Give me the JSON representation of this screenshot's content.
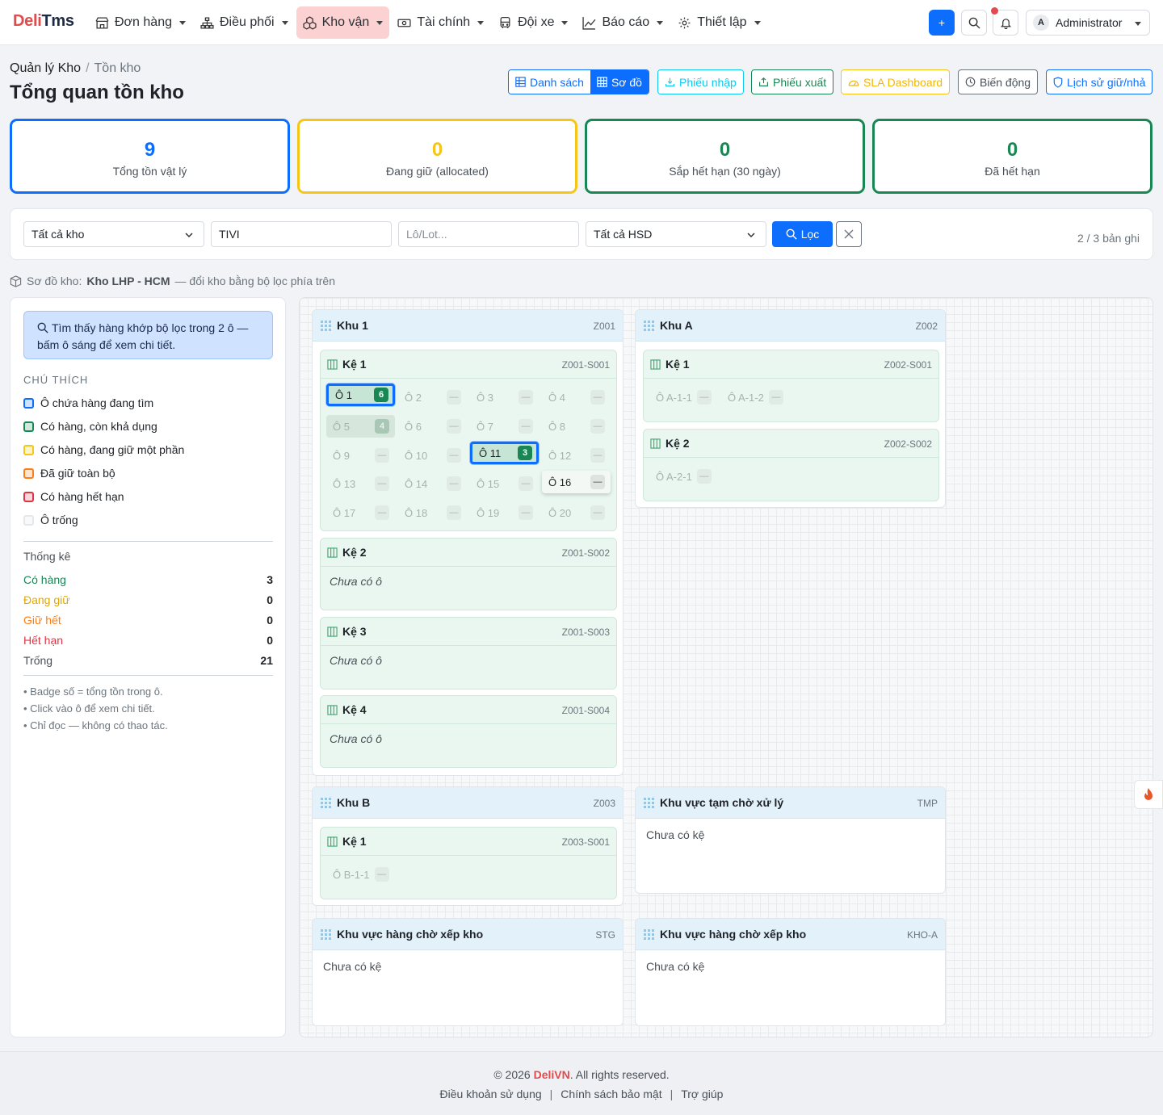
{
  "logo": {
    "part1": "Deli",
    "part2": "Tms"
  },
  "nav": [
    {
      "label": "Đơn hàng",
      "icon": "store-icon"
    },
    {
      "label": "Điều phối",
      "icon": "network-icon"
    },
    {
      "label": "Kho vận",
      "icon": "boxes-icon",
      "active": true
    },
    {
      "label": "Tài chính",
      "icon": "cash-icon"
    },
    {
      "label": "Đội xe",
      "icon": "bus-icon"
    },
    {
      "label": "Báo cáo",
      "icon": "chart-icon"
    },
    {
      "label": "Thiết lập",
      "icon": "gear-icon"
    }
  ],
  "topbar": {
    "add_label": "+",
    "user_initial": "A",
    "user_name": "Administrator"
  },
  "breadcrumb": {
    "root": "Quản lý Kho",
    "sep": "/",
    "current": "Tồn kho"
  },
  "page_title": "Tổng quan tồn kho",
  "view_toggle": {
    "list": "Danh sách",
    "map": "Sơ đồ"
  },
  "actions": {
    "import": "Phiếu nhập",
    "export": "Phiếu xuất",
    "sla": "SLA Dashboard",
    "movement": "Biến động",
    "history": "Lịch sử giữ/nhả"
  },
  "stats": [
    {
      "value": "9",
      "label": "Tổng tồn vật lý",
      "color": "#0d6efd"
    },
    {
      "value": "0",
      "label": "Đang giữ (allocated)",
      "color": "#f5c518"
    },
    {
      "value": "0",
      "label": "Sắp hết hạn (30 ngày)",
      "color": "#198754"
    },
    {
      "value": "0",
      "label": "Đã hết hạn",
      "color": "#198754"
    }
  ],
  "filter": {
    "warehouse": "Tất cả kho",
    "product": "TIVI",
    "lot_placeholder": "Lô/Lot...",
    "expiry": "Tất cả HSD",
    "filter_button": "Lọc",
    "record_count": "2 / 3 bản ghi"
  },
  "map_note": {
    "prefix": "Sơ đồ kho:",
    "warehouse": "Kho LHP - HCM",
    "suffix": "— đổi kho bằng bộ lọc phía trên"
  },
  "sidebar": {
    "alert": "Tìm thấy hàng khớp bộ lọc trong 2 ô — bấm ô sáng để xem chi tiết.",
    "legend_title": "CHÚ THÍCH",
    "legend": [
      {
        "label": "Ô chứa hàng đang tìm",
        "color": "#0d6efd",
        "fill": "#cfe2ff"
      },
      {
        "label": "Có hàng, còn khả dụng",
        "color": "#198754",
        "fill": "#d1e7dd"
      },
      {
        "label": "Có hàng, đang giữ một phần",
        "color": "#f5c518",
        "fill": "#fff3cd"
      },
      {
        "label": "Đã giữ toàn bộ",
        "color": "#fd7e14",
        "fill": "#ffe5d0"
      },
      {
        "label": "Có hàng hết hạn",
        "color": "#dc3545",
        "fill": "#f8d7da"
      },
      {
        "label": "Ô trống",
        "color": "#e5e7ea",
        "fill": "#f8f9fa"
      }
    ],
    "stats_title": "Thống kê",
    "stats": [
      {
        "label": "Có hàng",
        "value": "3",
        "color": "#198754"
      },
      {
        "label": "Đang giữ",
        "value": "0",
        "color": "#e0a800"
      },
      {
        "label": "Giữ hết",
        "value": "0",
        "color": "#fd7e14"
      },
      {
        "label": "Hết hạn",
        "value": "0",
        "color": "#dc3545"
      },
      {
        "label": "Trống",
        "value": "21",
        "color": "#495057"
      }
    ],
    "notes": [
      "• Badge số = tổng tồn trong ô.",
      "• Click vào ô để xem chi tiết.",
      "• Chỉ đọc — không có thao tác."
    ]
  },
  "zones": {
    "z1": {
      "name": "Khu 1",
      "code": "Z001"
    },
    "za": {
      "name": "Khu A",
      "code": "Z002"
    },
    "zb": {
      "name": "Khu B",
      "code": "Z003"
    },
    "tmp": {
      "name": "Khu vực tạm chờ xử lý",
      "code": "TMP",
      "empty": "Chưa có kệ"
    },
    "stg": {
      "name": "Khu vực hàng chờ xếp kho",
      "code": "STG",
      "empty": "Chưa có kệ"
    },
    "khoa": {
      "name": "Khu vực hàng chờ xếp kho",
      "code": "KHO-A",
      "empty": "Chưa có kệ"
    }
  },
  "shelves": {
    "z1s1": {
      "name": "Kệ 1",
      "code": "Z001-S001"
    },
    "z1s2": {
      "name": "Kệ 2",
      "code": "Z001-S002",
      "empty": "Chưa có ô"
    },
    "z1s3": {
      "name": "Kệ 3",
      "code": "Z001-S003",
      "empty": "Chưa có ô"
    },
    "z1s4": {
      "name": "Kệ 4",
      "code": "Z001-S004",
      "empty": "Chưa có ô"
    },
    "zas1": {
      "name": "Kệ 1",
      "code": "Z002-S001"
    },
    "zas2": {
      "name": "Kệ 2",
      "code": "Z002-S002"
    },
    "zbs1": {
      "name": "Kệ 1",
      "code": "Z003-S001"
    }
  },
  "cells_z1s1": [
    {
      "label": "Ô 1",
      "badge": "6",
      "state": "hit"
    },
    {
      "label": "Ô 2",
      "badge": "—",
      "state": "empty"
    },
    {
      "label": "Ô 3",
      "badge": "—",
      "state": "empty"
    },
    {
      "label": "Ô 4",
      "badge": "—",
      "state": "empty"
    },
    {
      "label": "Ô 5",
      "badge": "4",
      "state": "has"
    },
    {
      "label": "Ô 6",
      "badge": "—",
      "state": "empty"
    },
    {
      "label": "Ô 7",
      "badge": "—",
      "state": "empty"
    },
    {
      "label": "Ô 8",
      "badge": "—",
      "state": "empty"
    },
    {
      "label": "Ô 9",
      "badge": "—",
      "state": "empty"
    },
    {
      "label": "Ô 10",
      "badge": "—",
      "state": "empty"
    },
    {
      "label": "Ô 11",
      "badge": "3",
      "state": "hit"
    },
    {
      "label": "Ô 12",
      "badge": "—",
      "state": "empty"
    },
    {
      "label": "Ô 13",
      "badge": "—",
      "state": "empty"
    },
    {
      "label": "Ô 14",
      "badge": "—",
      "state": "empty"
    },
    {
      "label": "Ô 15",
      "badge": "—",
      "state": "empty"
    },
    {
      "label": "Ô 16",
      "badge": "—",
      "state": "hover"
    },
    {
      "label": "Ô 17",
      "badge": "—",
      "state": "empty"
    },
    {
      "label": "Ô 18",
      "badge": "—",
      "state": "empty"
    },
    {
      "label": "Ô 19",
      "badge": "—",
      "state": "empty"
    },
    {
      "label": "Ô 20",
      "badge": "—",
      "state": "empty"
    }
  ],
  "cells_small": {
    "a11": {
      "label": "Ô A-1-1",
      "badge": "—"
    },
    "a12": {
      "label": "Ô A-1-2",
      "badge": "—"
    },
    "a21": {
      "label": "Ô A-2-1",
      "badge": "—"
    },
    "b11": {
      "label": "Ô B-1-1",
      "badge": "—"
    }
  },
  "footer": {
    "copy_prefix": "© 2026",
    "brand": "DeliVN",
    "copy_suffix": ". All rights reserved.",
    "terms": "Điều khoản sử dụng",
    "privacy": "Chính sách bảo mật",
    "help": "Trợ giúp",
    "sep": "|"
  }
}
